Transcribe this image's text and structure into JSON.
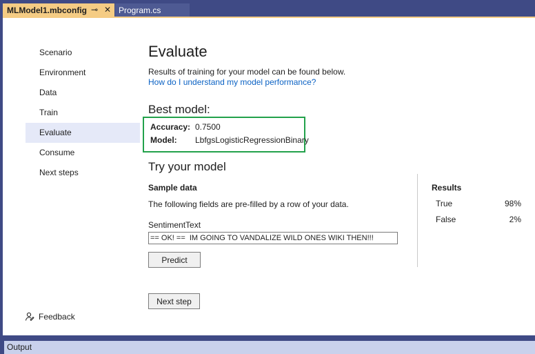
{
  "tabs": [
    {
      "label": "MLModel1.mbconfig",
      "active": true
    },
    {
      "label": "Program.cs",
      "active": false
    }
  ],
  "icons": {
    "pin": "pin-icon",
    "close": "close-icon",
    "feedback": "feedback-icon"
  },
  "nav": {
    "items": [
      {
        "label": "Scenario"
      },
      {
        "label": "Environment"
      },
      {
        "label": "Data"
      },
      {
        "label": "Train"
      },
      {
        "label": "Evaluate",
        "selected": true
      },
      {
        "label": "Consume"
      },
      {
        "label": "Next steps"
      }
    ],
    "feedback_label": "Feedback"
  },
  "main": {
    "title": "Evaluate",
    "subtitle": "Results of training for your model can be found below.",
    "help_link": "How do I understand my model performance?",
    "best_model": {
      "title": "Best model:",
      "accuracy_label": "Accuracy:",
      "accuracy_value": "0.7500",
      "model_label": "Model:",
      "model_value": "LbfgsLogisticRegressionBinary"
    },
    "try": {
      "title": "Try your model",
      "sample_title": "Sample data",
      "sample_desc": "The following fields are pre-filled by a row of your data.",
      "field_label": "SentimentText",
      "field_value": "== OK! ==  IM GOING TO VANDALIZE WILD ONES WIKI THEN!!!",
      "predict_label": "Predict"
    },
    "results": {
      "title": "Results",
      "rows": [
        {
          "label": "True",
          "value": "98%"
        },
        {
          "label": "False",
          "value": "2%"
        }
      ]
    },
    "next_step_label": "Next step"
  },
  "bottom": {
    "output_label": "Output"
  },
  "colors": {
    "chrome": "#3f4a85",
    "active_tab": "#f5cc84",
    "highlight_box": "#21a14a",
    "link": "#0b62c4",
    "nav_selected": "#e5e9f8"
  }
}
